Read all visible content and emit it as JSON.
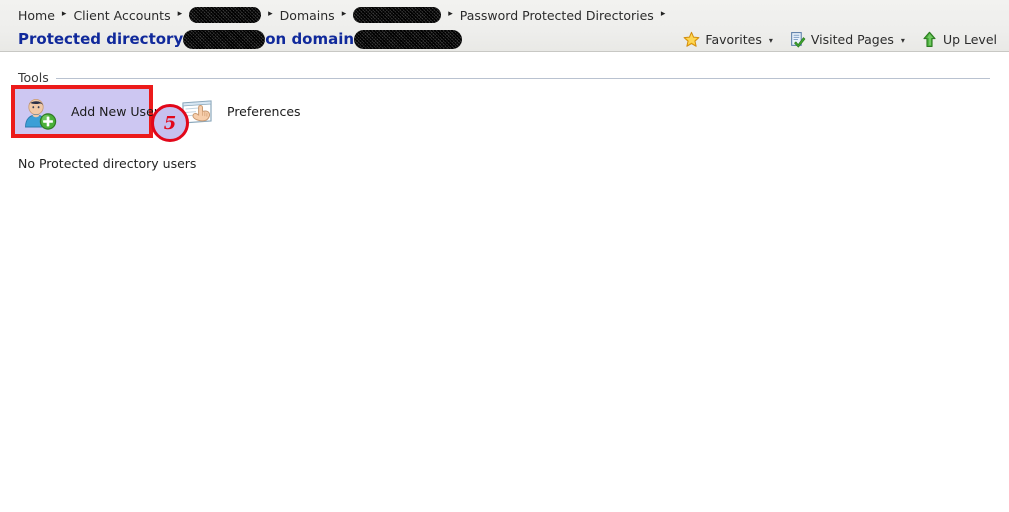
{
  "header": {
    "breadcrumb": [
      {
        "type": "link",
        "label": "Home"
      },
      {
        "type": "link",
        "label": "Client Accounts"
      },
      {
        "type": "redacted",
        "label": "",
        "width": 72
      },
      {
        "type": "link",
        "label": "Domains"
      },
      {
        "type": "redacted",
        "label": "",
        "width": 88
      },
      {
        "type": "link",
        "label": "Password Protected Directories"
      }
    ],
    "separator": "▸",
    "title": {
      "part1": "Protected directory",
      "redact1_width": 82,
      "part2": "on domain",
      "redact2_width": 108,
      "color": "#10299b"
    },
    "tools": [
      {
        "label": "Favorites",
        "icon": "star-icon",
        "has_caret": true
      },
      {
        "label": "Visited Pages",
        "icon": "visited-pages-icon",
        "has_caret": true
      },
      {
        "label": "Up Level",
        "icon": "up-arrow-icon",
        "has_caret": false
      }
    ],
    "caret": "▾"
  },
  "main": {
    "tools_section": {
      "label": "Tools",
      "items": [
        {
          "label": "Add New User",
          "icon": "add-user-icon",
          "highlighted": true
        },
        {
          "label": "Preferences",
          "icon": "preferences-icon",
          "highlighted": false
        }
      ]
    },
    "annotation": {
      "number": "5",
      "ring_color": "#e2071a",
      "fill_color": "#c6c0ef"
    },
    "empty_message": "No Protected directory users"
  },
  "colors": {
    "header_background": "#eeeeec",
    "title_blue": "#10299b",
    "highlight_fill": "#cdc7f2",
    "highlight_border": "#ec1b1b",
    "rule": "#b9c2d0"
  }
}
